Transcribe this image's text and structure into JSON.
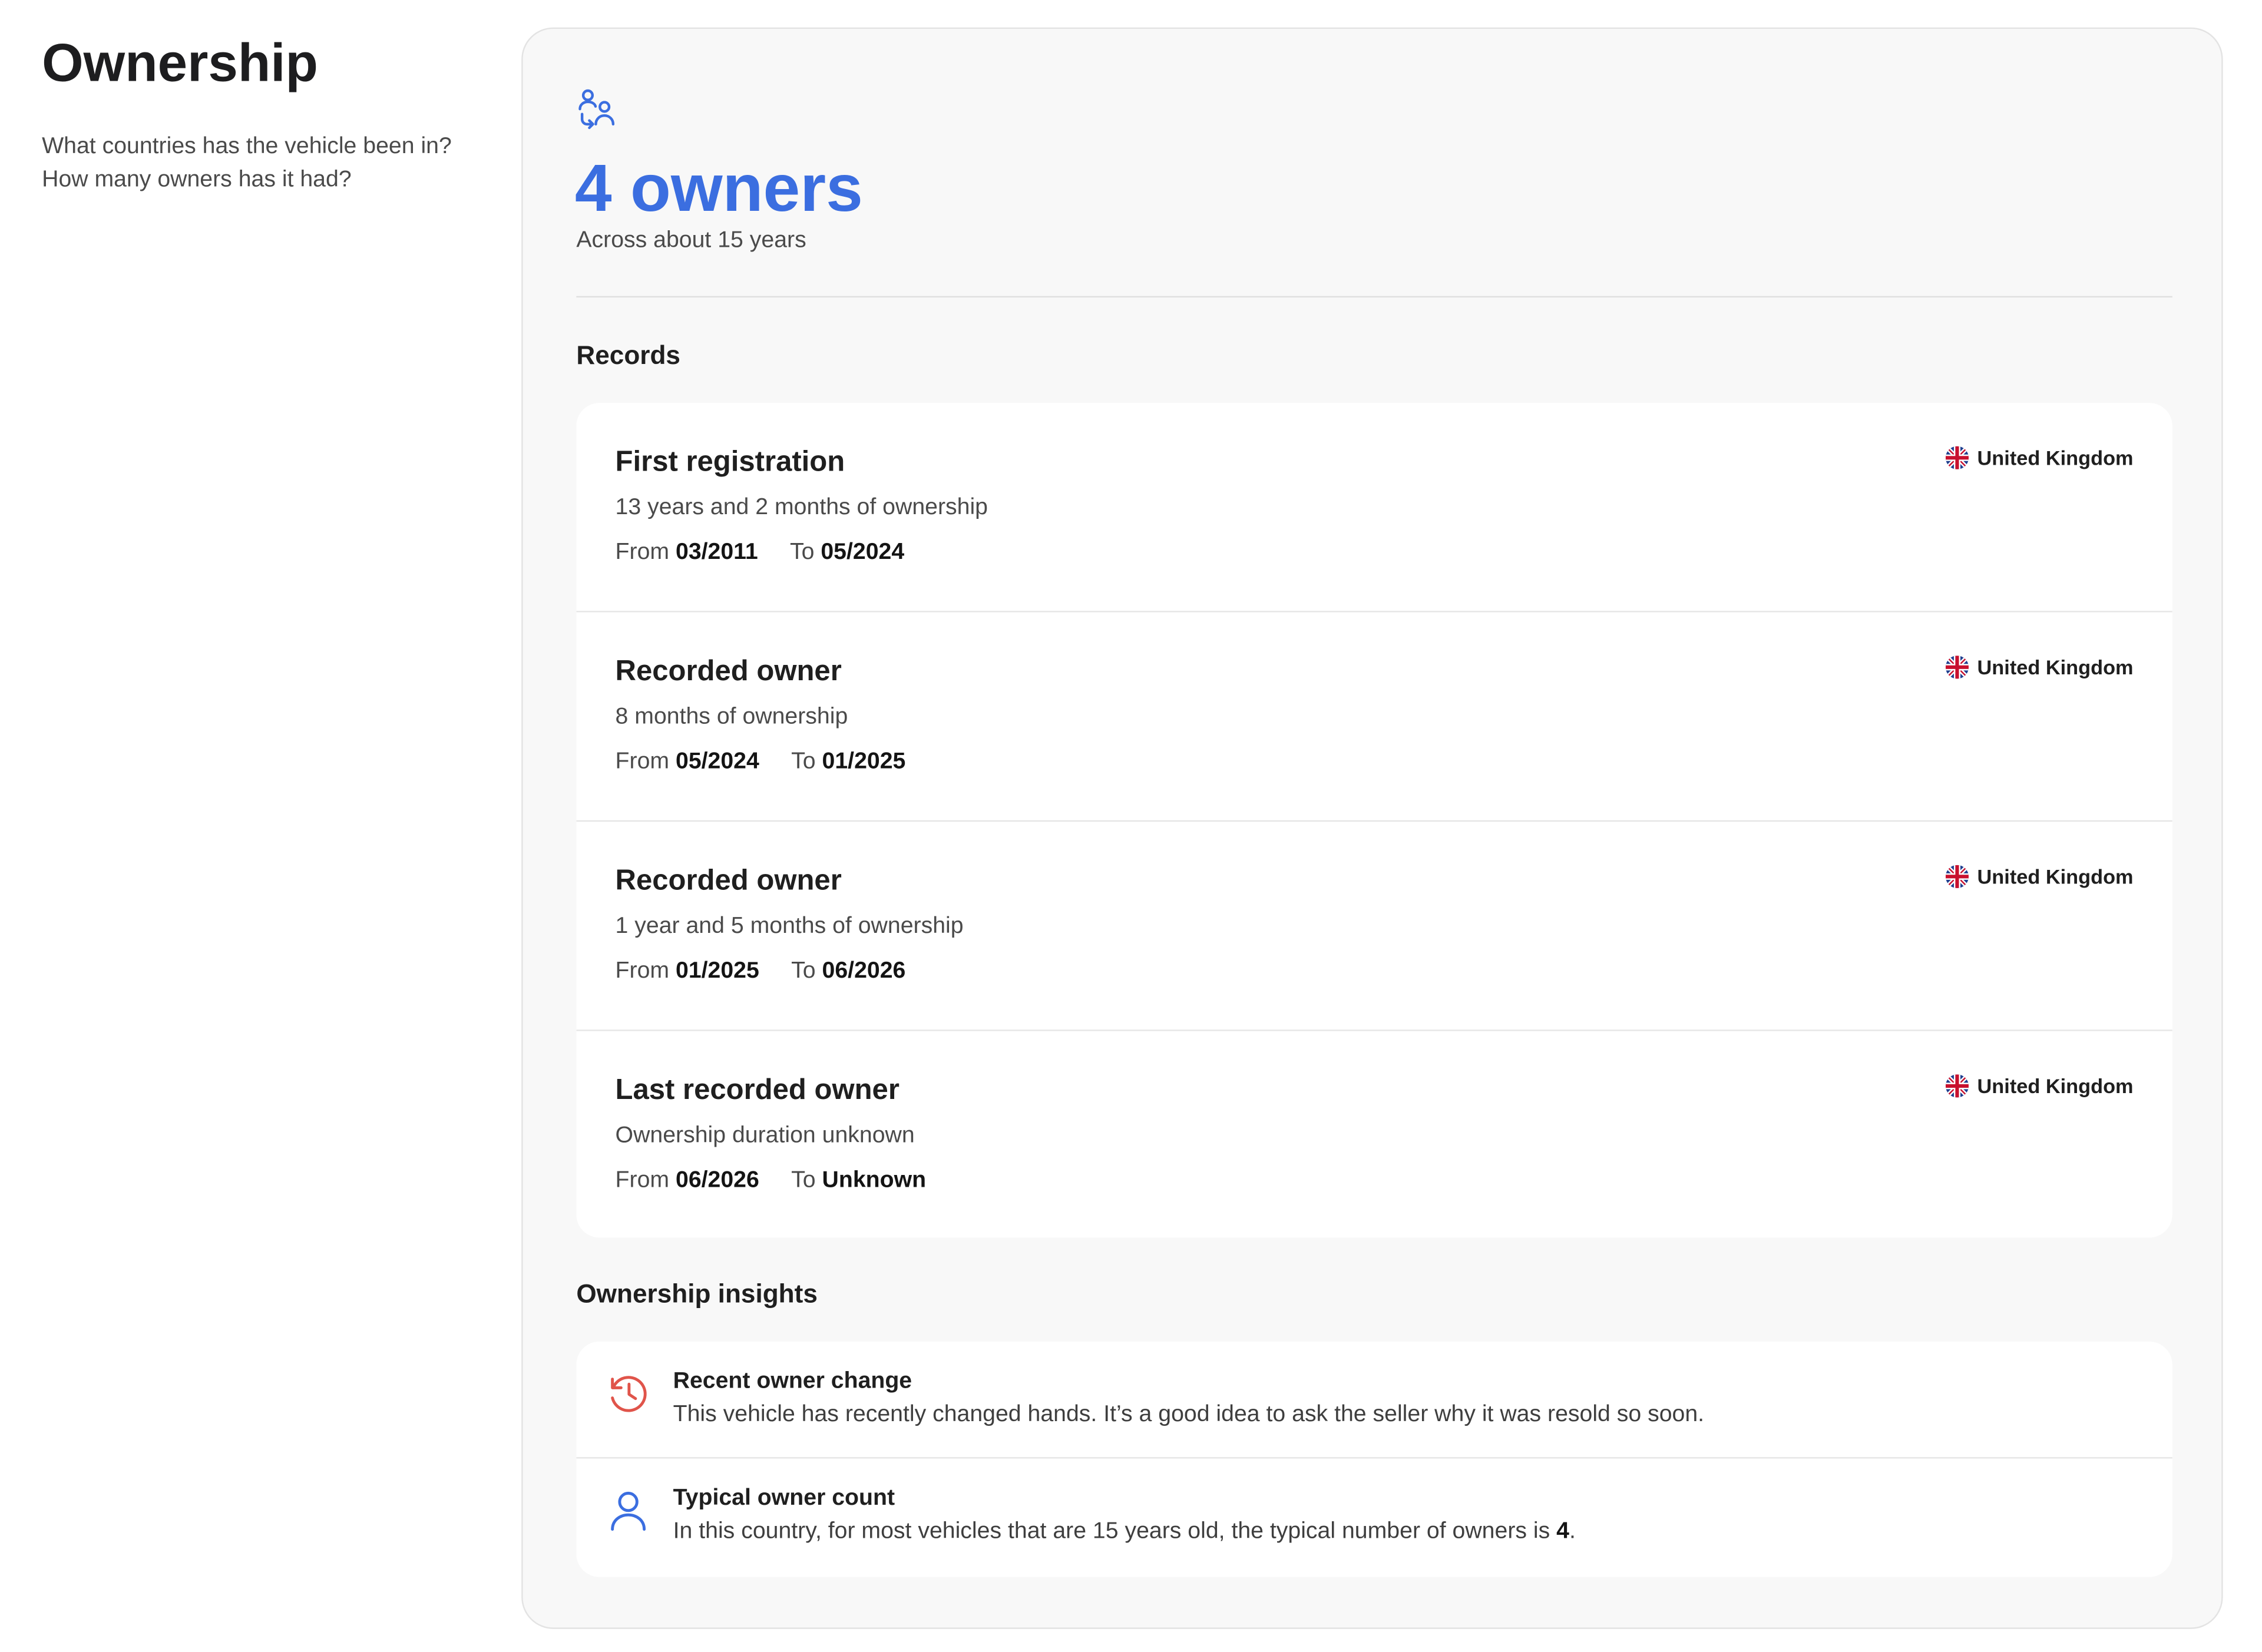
{
  "intro": {
    "title": "Ownership",
    "description": "What countries has the vehicle been in? How many owners has it had?"
  },
  "summary": {
    "icon": "owners-transfer-icon",
    "count_label": "4 owners",
    "period": "Across about 15 years"
  },
  "records": {
    "heading": "Records",
    "from_label": "From",
    "to_label": "To",
    "items": [
      {
        "title": "First registration",
        "duration": "13 years and 2 months of ownership",
        "from": "03/2011",
        "to": "05/2024",
        "country": "United Kingdom"
      },
      {
        "title": "Recorded owner",
        "duration": "8 months of ownership",
        "from": "05/2024",
        "to": "01/2025",
        "country": "United Kingdom"
      },
      {
        "title": "Recorded owner",
        "duration": "1 year and 5 months of ownership",
        "from": "01/2025",
        "to": "06/2026",
        "country": "United Kingdom"
      },
      {
        "title": "Last recorded owner",
        "duration": "Ownership duration unknown",
        "from": "06/2026",
        "to": "Unknown",
        "country": "United Kingdom"
      }
    ]
  },
  "insights": {
    "heading": "Ownership insights",
    "items": [
      {
        "icon": "history-clock-icon",
        "title": "Recent owner change",
        "text": "This vehicle has recently changed hands. It’s a good idea to ask the seller why it was resold so soon."
      },
      {
        "icon": "person-icon",
        "title": "Typical owner count",
        "text_before": "In this country, for most vehicles that are 15 years old, the typical number of owners is ",
        "text_bold": "4",
        "text_after": "."
      }
    ]
  },
  "colors": {
    "accent": "#3b6ee0",
    "warning": "#e0544a",
    "card_background": "#f8f8f8"
  }
}
